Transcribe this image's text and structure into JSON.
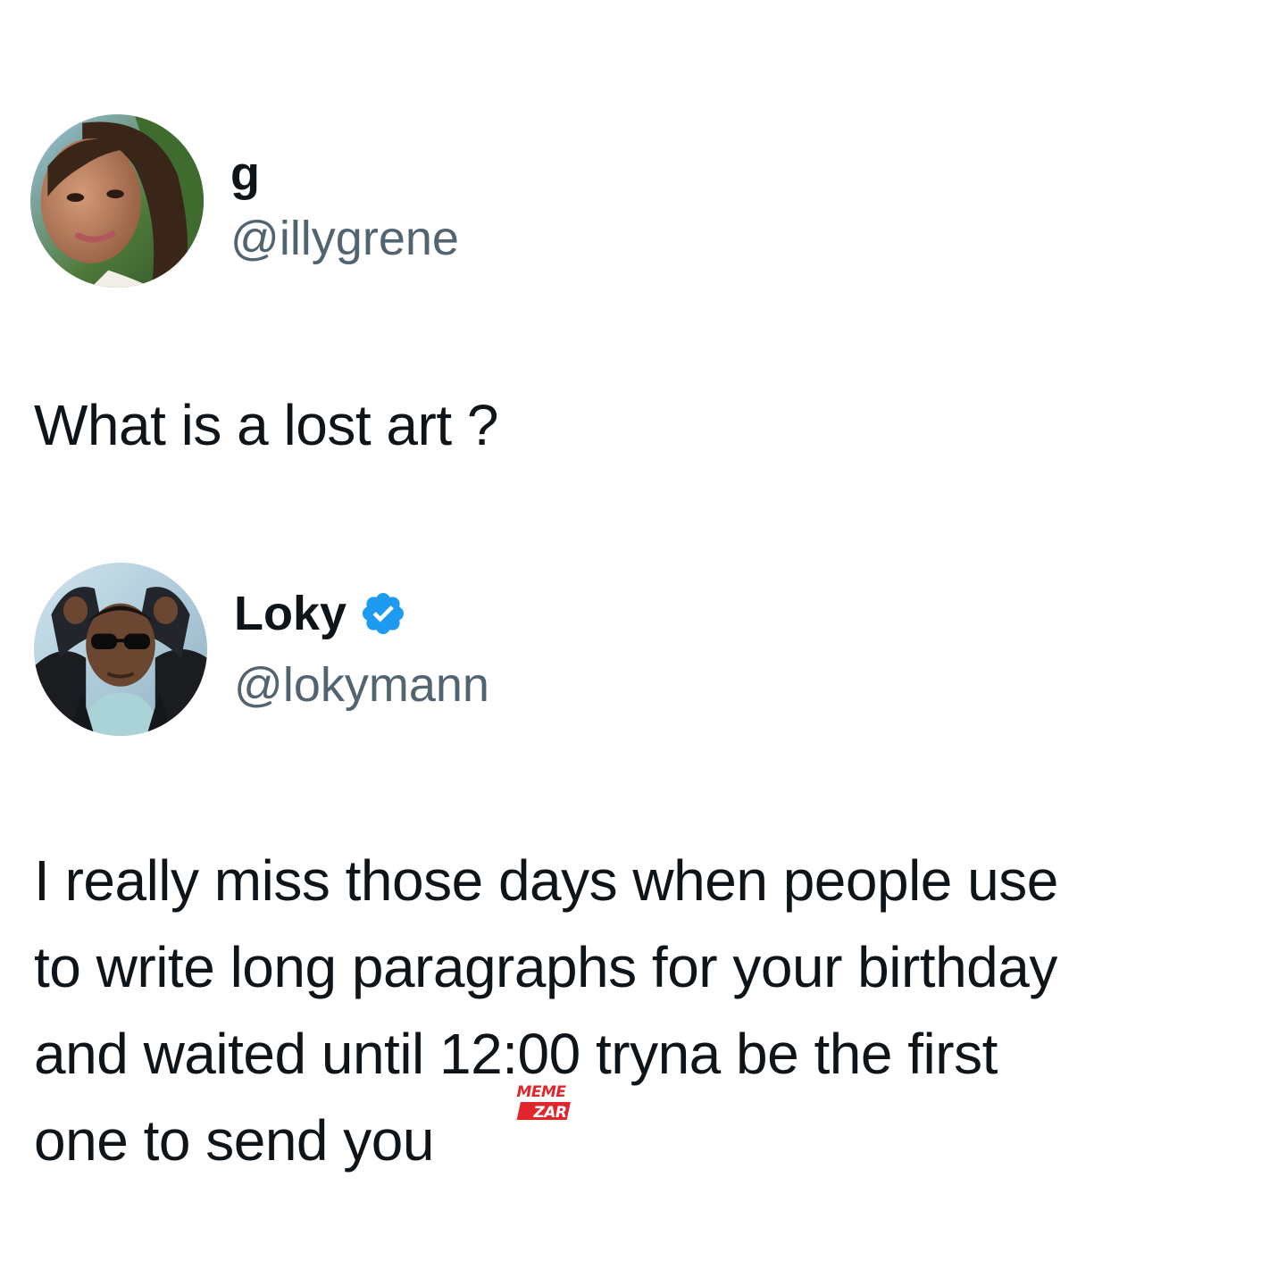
{
  "tweets": [
    {
      "display_name": "g",
      "handle": "@illygrene",
      "verified": false,
      "avatar_icon": "profile-photo",
      "text_lines": [
        "What is a lost art ?"
      ]
    },
    {
      "display_name": "Loky",
      "handle": "@lokymann",
      "verified": true,
      "avatar_icon": "profile-photo",
      "text_lines": [
        "I really miss those days when people use",
        "to write long paragraphs for your birthday",
        "and waited until 12:00 tryna be the first",
        "one to send you"
      ]
    }
  ],
  "watermark": {
    "line1": "MEME",
    "line2": "ZAR",
    "color": "#e0262a"
  },
  "colors": {
    "text": "#0f1419",
    "handle": "#536471",
    "verified_badge": "#1d9bf0",
    "background": "#ffffff"
  }
}
